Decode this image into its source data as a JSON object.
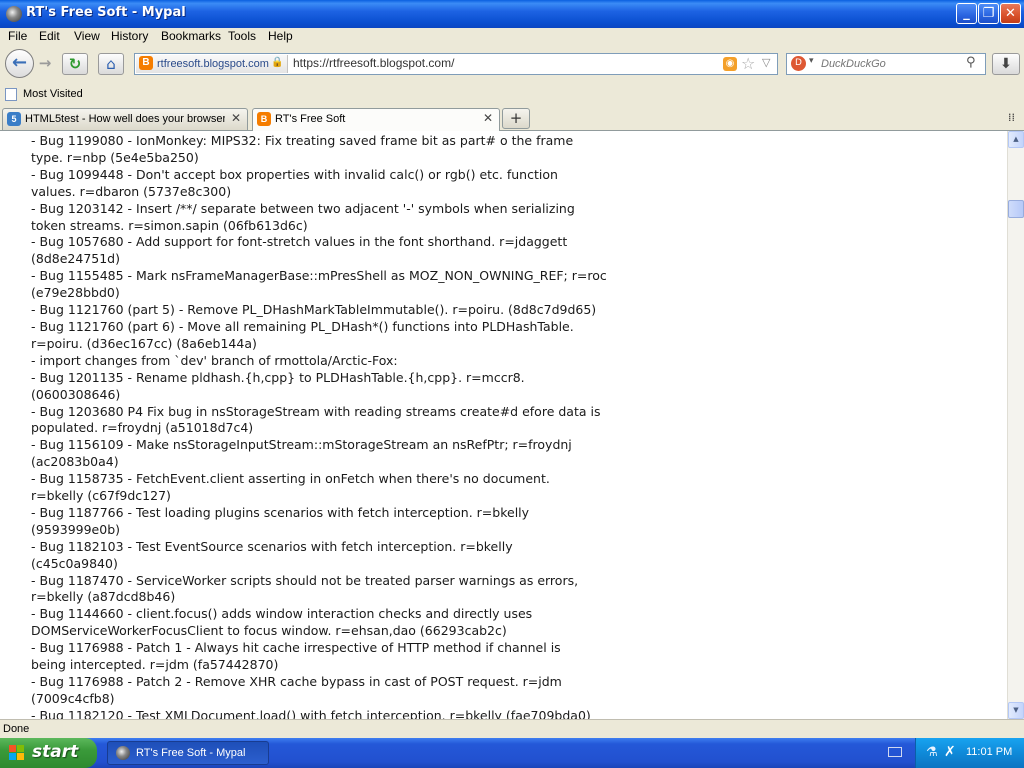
{
  "window": {
    "title": "RT's Free Soft - Mypal",
    "buttons": {
      "minimize": "_",
      "maximize": "❐",
      "close": "✕"
    }
  },
  "menubar": {
    "items": [
      "File",
      "Edit",
      "View",
      "History",
      "Bookmarks",
      "Tools",
      "Help"
    ]
  },
  "navbar": {
    "identity_label": "rtfreesoft.blogspot.com",
    "url": "https://rtfreesoft.blogspot.com/",
    "search_placeholder": "DuckDuckGo"
  },
  "bookmarks": {
    "items": [
      {
        "label": "Most Visited"
      }
    ]
  },
  "tabs": [
    {
      "label": "HTML5test - How well does your browser...",
      "active": false,
      "icon": "html5-icon"
    },
    {
      "label": "RT's Free Soft",
      "active": true,
      "icon": "blogger-icon"
    }
  ],
  "content": {
    "lines": [
      "  - Bug 1199080 - IonMonkey: MIPS32: Fix treating saved frame bit as part# o the frame",
      "type. r=nbp (5e4e5ba250)",
      "  - Bug 1099448 - Don't accept box properties with invalid calc() or rgb() etc. function",
      "values. r=dbaron (5737e8c300)",
      "  - Bug 1203142 - Insert /**/ separate between two adjacent '-' symbols when serializing",
      "token streams. r=simon.sapin (06fb613d6c)",
      "  - Bug 1057680 - Add support for font-stretch values in the font shorthand. r=jdaggett",
      "(8d8e24751d)",
      "  - Bug 1155485 - Mark nsFrameManagerBase::mPresShell as MOZ_NON_OWNING_REF; r=roc",
      "(e79e28bbd0)",
      "  - Bug 1121760 (part 5) - Remove PL_DHashMarkTableImmutable(). r=poiru. (8d8c7d9d65)",
      "  - Bug 1121760 (part 6) - Move all remaining PL_DHash*() functions into PLDHashTable.",
      "r=poiru. (d36ec167cc) (8a6eb144a)",
      "- import changes from `dev' branch of rmottola/Arctic-Fox:",
      "  - Bug 1201135 - Rename pldhash.{h,cpp} to PLDHashTable.{h,cpp}. r=mccr8.",
      "(0600308646)",
      "  - Bug 1203680 P4 Fix bug in nsStorageStream with reading streams create#d efore data is",
      "populated. r=froydnj (a51018d7c4)",
      "  - Bug 1156109 - Make nsStorageInputStream::mStorageStream an nsRefPtr; r=froydnj",
      "(ac2083b0a4)",
      "  - Bug 1158735 - FetchEvent.client asserting in onFetch when there's no document.",
      "r=bkelly (c67f9dc127)",
      "  - Bug 1187766 - Test loading plugins scenarios with fetch interception. r=bkelly",
      "(9593999e0b)",
      "  - Bug 1182103 - Test EventSource scenarios with fetch interception. r=bkelly",
      "(c45c0a9840)",
      "  - Bug 1187470 - ServiceWorker scripts should not be treated parser warnings as errors,",
      "r=bkelly (a87dcd8b46)",
      "  - Bug 1144660 - client.focus() adds window interaction checks and directly uses",
      "DOMServiceWorkerFocusClient to focus window. r=ehsan,dao (66293cab2c)",
      "  - Bug 1176988 - Patch 1 - Always hit cache irrespective of HTTP method if channel is",
      "being intercepted. r=jdm (fa57442870)",
      "  - Bug 1176988 - Patch 2 - Remove XHR cache bypass in cast of POST request. r=jdm",
      "(7009c4cfb8)",
      "  - Bug 1182120 - Test XMLDocument.load() with fetch interception. r=bkelly (fae709bda0)"
    ]
  },
  "statusbar": {
    "text": "Done"
  },
  "taskbar": {
    "start_label": "start",
    "task_label": "RT's Free Soft - Mypal",
    "clock": "11:01 PM"
  }
}
